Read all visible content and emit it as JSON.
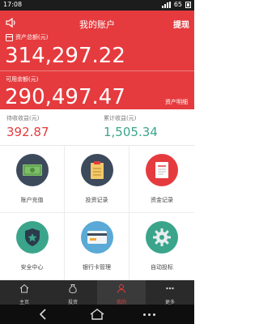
{
  "status_bar": {
    "time": "17:08",
    "battery": "65"
  },
  "header": {
    "title": "我的账户",
    "withdraw": "提现",
    "total_assets_label": "资产总额(元)",
    "total_assets_value": "314,297.22",
    "available_balance_label": "可用余额(元)",
    "available_balance_value": "290,497.47",
    "asset_detail_link": "资产明细"
  },
  "earnings": {
    "pending": {
      "label": "待收收益(元)",
      "value": "392.87"
    },
    "accumulated": {
      "label": "累计收益(元)",
      "value": "1,505.34"
    }
  },
  "grid": [
    {
      "label": "账户充值",
      "icon": "cash-icon",
      "color": "#3d4a5c"
    },
    {
      "label": "投资记录",
      "icon": "document-list-icon",
      "color": "#3d4a5c"
    },
    {
      "label": "资金记录",
      "icon": "record-sheet-icon",
      "color": "#e53b3e"
    },
    {
      "label": "安全中心",
      "icon": "shield-star-icon",
      "color": "#3aa58b"
    },
    {
      "label": "银行卡管理",
      "icon": "bank-card-icon",
      "color": "#5aa9d6"
    },
    {
      "label": "自动投标",
      "icon": "gear-icon",
      "color": "#3aa58b"
    }
  ],
  "tabs": [
    {
      "label": "主页",
      "icon": "home-icon"
    },
    {
      "label": "投资",
      "icon": "money-bag-icon"
    },
    {
      "label": "我的",
      "icon": "person-icon"
    },
    {
      "label": "更多",
      "icon": "more-icon"
    }
  ]
}
